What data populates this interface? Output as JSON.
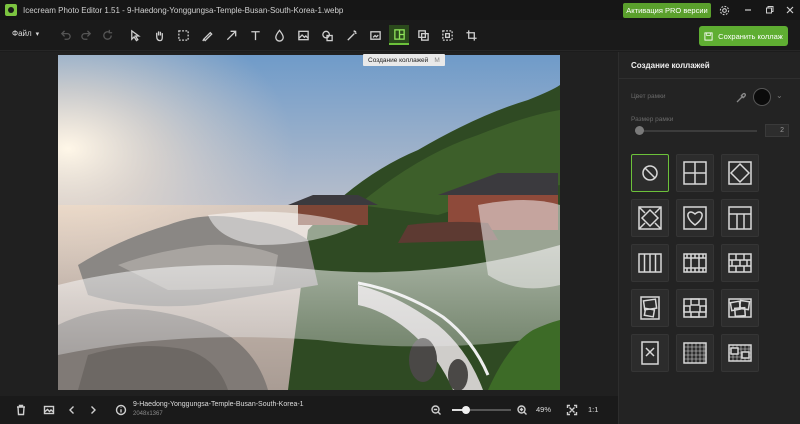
{
  "window": {
    "title": "Icecream Photo Editor 1.51 - 9-Haedong-Yonggungsa-Temple-Busan-South-Korea-1.webp",
    "pro_button": "Активация PRO версии",
    "icons": [
      "app-icon",
      "settings-icon",
      "minimize-icon",
      "maximize-icon",
      "close-icon"
    ]
  },
  "toolbar": {
    "file_menu": "Файл",
    "save_button": "Сохранить коллаж",
    "tooltip_label": "Создание коллажей",
    "tooltip_key": "M",
    "tools": [
      "undo",
      "redo",
      "reset",
      "select",
      "hand",
      "marquee",
      "brush",
      "arrow",
      "text",
      "drop",
      "image",
      "shapes",
      "magic-wand",
      "crop-frame",
      "collage",
      "layers",
      "transform",
      "crop"
    ],
    "active_tool": "collage"
  },
  "bottom": {
    "filename": "9-Haedong-Yonggungsa-Temple-Busan-South-Korea-1",
    "dimensions": "2048x1367",
    "zoom": "49%",
    "zoom_level": 0.49,
    "one_to_one": "1:1"
  },
  "panel": {
    "title": "Создание коллажей",
    "frame_color_label": "Цвет рамки",
    "frame_color": "#0b0b0b",
    "frame_size_label": "Размер рамки",
    "frame_size_value": "2",
    "layouts": [
      "none",
      "grid-2x2",
      "diamond",
      "diamond-frame",
      "heart",
      "header-split",
      "columns-4",
      "strip-film",
      "bricks",
      "collage-scatter",
      "polaroid-cross",
      "tilted-photos",
      "cross-photo",
      "checker-strip",
      "checker-scatter"
    ],
    "selected_layout": "none"
  },
  "colors": {
    "accent": "#6cc13a",
    "pro_green": "#5aa02c"
  }
}
